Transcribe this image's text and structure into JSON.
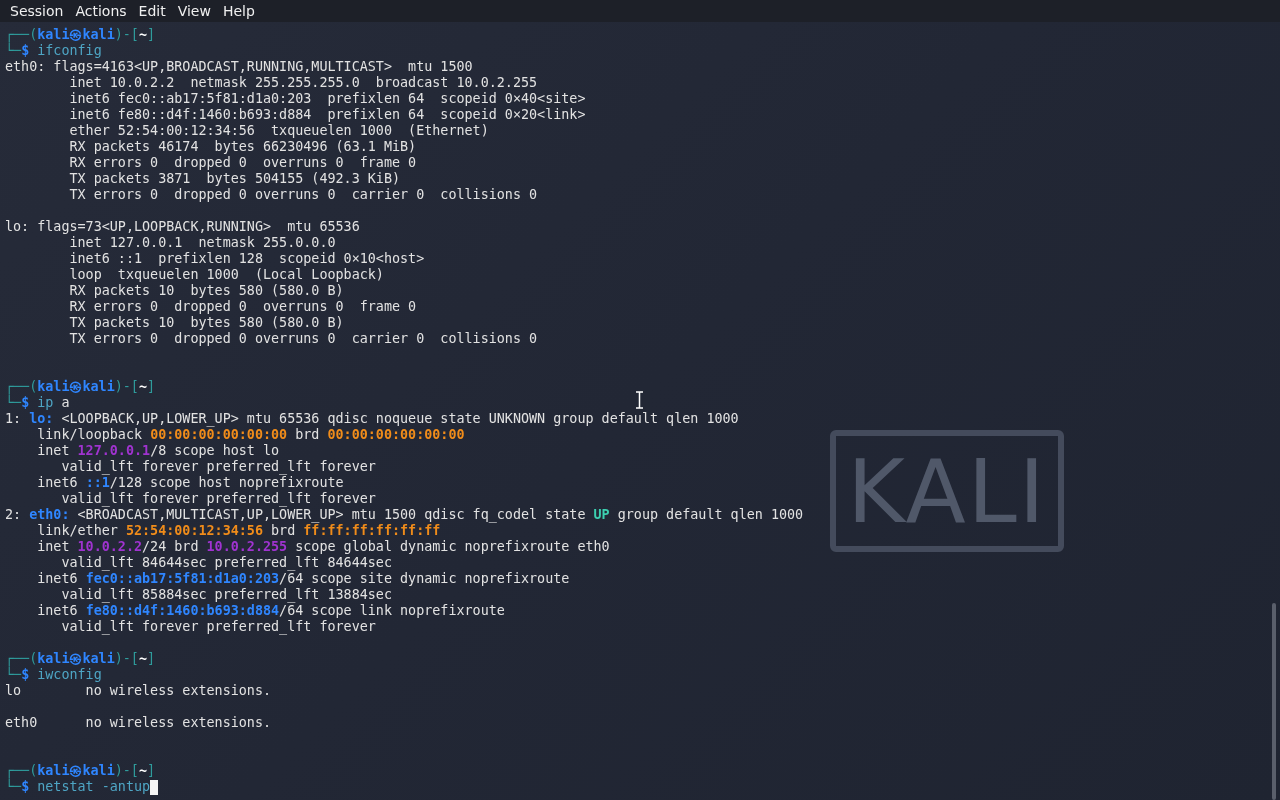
{
  "menu": [
    "Session",
    "Actions",
    "Edit",
    "View",
    "Help"
  ],
  "wallpaper": {
    "logo_text": "KALI"
  },
  "terminal": {
    "lines": [
      {
        "segments": [
          {
            "text": "┌──(",
            "kind": "frame"
          },
          {
            "text": "kali㉿kali",
            "kind": "userhost"
          },
          {
            "text": ")-[",
            "kind": "frame"
          },
          {
            "text": "~",
            "kind": "dir"
          },
          {
            "text": "]",
            "kind": "frame"
          }
        ]
      },
      {
        "segments": [
          {
            "text": "└─",
            "kind": "frame"
          },
          {
            "text": "$",
            "kind": "dollar"
          },
          {
            "text": " ifconfig",
            "kind": "command"
          }
        ]
      },
      {
        "segments": [
          {
            "text": "eth0: flags=4163<UP,BROADCAST,RUNNING,MULTICAST>  mtu 1500",
            "kind": "plain"
          }
        ]
      },
      {
        "segments": [
          {
            "text": "        inet 10.0.2.2  netmask 255.255.255.0  broadcast 10.0.2.255",
            "kind": "plain"
          }
        ]
      },
      {
        "segments": [
          {
            "text": "        inet6 fec0::ab17:5f81:d1a0:203  prefixlen 64  scopeid 0×40<site>",
            "kind": "plain"
          }
        ]
      },
      {
        "segments": [
          {
            "text": "        inet6 fe80::d4f:1460:b693:d884  prefixlen 64  scopeid 0×20<link>",
            "kind": "plain"
          }
        ]
      },
      {
        "segments": [
          {
            "text": "        ether 52:54:00:12:34:56  txqueuelen 1000  (Ethernet)",
            "kind": "plain"
          }
        ]
      },
      {
        "segments": [
          {
            "text": "        RX packets 46174  bytes 66230496 (63.1 MiB)",
            "kind": "plain"
          }
        ]
      },
      {
        "segments": [
          {
            "text": "        RX errors 0  dropped 0  overruns 0  frame 0",
            "kind": "plain"
          }
        ]
      },
      {
        "segments": [
          {
            "text": "        TX packets 3871  bytes 504155 (492.3 KiB)",
            "kind": "plain"
          }
        ]
      },
      {
        "segments": [
          {
            "text": "        TX errors 0  dropped 0 overruns 0  carrier 0  collisions 0",
            "kind": "plain"
          }
        ]
      },
      {
        "kind": "blank"
      },
      {
        "segments": [
          {
            "text": "lo: flags=73<UP,LOOPBACK,RUNNING>  mtu 65536",
            "kind": "plain"
          }
        ]
      },
      {
        "segments": [
          {
            "text": "        inet 127.0.0.1  netmask 255.0.0.0",
            "kind": "plain"
          }
        ]
      },
      {
        "segments": [
          {
            "text": "        inet6 ::1  prefixlen 128  scopeid 0×10<host>",
            "kind": "plain"
          }
        ]
      },
      {
        "segments": [
          {
            "text": "        loop  txqueuelen 1000  (Local Loopback)",
            "kind": "plain"
          }
        ]
      },
      {
        "segments": [
          {
            "text": "        RX packets 10  bytes 580 (580.0 B)",
            "kind": "plain"
          }
        ]
      },
      {
        "segments": [
          {
            "text": "        RX errors 0  dropped 0  overruns 0  frame 0",
            "kind": "plain"
          }
        ]
      },
      {
        "segments": [
          {
            "text": "        TX packets 10  bytes 580 (580.0 B)",
            "kind": "plain"
          }
        ]
      },
      {
        "segments": [
          {
            "text": "        TX errors 0  dropped 0 overruns 0  carrier 0  collisions 0",
            "kind": "plain"
          }
        ]
      },
      {
        "kind": "blank"
      },
      {
        "kind": "blank"
      },
      {
        "segments": [
          {
            "text": "┌──(",
            "kind": "frame"
          },
          {
            "text": "kali㉿kali",
            "kind": "userhost"
          },
          {
            "text": ")-[",
            "kind": "frame"
          },
          {
            "text": "~",
            "kind": "dir"
          },
          {
            "text": "]",
            "kind": "frame"
          }
        ]
      },
      {
        "segments": [
          {
            "text": "└─",
            "kind": "frame"
          },
          {
            "text": "$",
            "kind": "dollar"
          },
          {
            "text": " ip",
            "kind": "command"
          },
          {
            "text": " a",
            "kind": "plain"
          }
        ]
      },
      {
        "segments": [
          {
            "text": "1: ",
            "kind": "plain"
          },
          {
            "text": "lo:",
            "kind": "iface"
          },
          {
            "text": " <LOOPBACK,UP,LOWER_UP> mtu 65536 qdisc noqueue state UNKNOWN group default qlen 1000",
            "kind": "plain"
          }
        ]
      },
      {
        "segments": [
          {
            "text": "    link/loopback ",
            "kind": "plain"
          },
          {
            "text": "00:00:00:00:00:00",
            "kind": "mac"
          },
          {
            "text": " brd ",
            "kind": "plain"
          },
          {
            "text": "00:00:00:00:00:00",
            "kind": "mac"
          }
        ]
      },
      {
        "segments": [
          {
            "text": "    inet ",
            "kind": "plain"
          },
          {
            "text": "127.0.0.1",
            "kind": "ipv4"
          },
          {
            "text": "/8 scope host lo",
            "kind": "plain"
          }
        ]
      },
      {
        "segments": [
          {
            "text": "       valid_lft forever preferred_lft forever",
            "kind": "plain"
          }
        ]
      },
      {
        "segments": [
          {
            "text": "    inet6 ",
            "kind": "plain"
          },
          {
            "text": "::1",
            "kind": "ipv6"
          },
          {
            "text": "/128 scope host noprefixroute",
            "kind": "plain"
          }
        ]
      },
      {
        "segments": [
          {
            "text": "       valid_lft forever preferred_lft forever",
            "kind": "plain"
          }
        ]
      },
      {
        "segments": [
          {
            "text": "2: ",
            "kind": "plain"
          },
          {
            "text": "eth0:",
            "kind": "iface"
          },
          {
            "text": " <BROADCAST,MULTICAST,UP,LOWER_UP> mtu 1500 qdisc fq_codel state ",
            "kind": "plain"
          },
          {
            "text": "UP",
            "kind": "state"
          },
          {
            "text": " group default qlen 1000",
            "kind": "plain"
          }
        ]
      },
      {
        "segments": [
          {
            "text": "    link/ether ",
            "kind": "plain"
          },
          {
            "text": "52:54:00:12:34:56",
            "kind": "mac"
          },
          {
            "text": " brd ",
            "kind": "plain"
          },
          {
            "text": "ff:ff:ff:ff:ff:ff",
            "kind": "mac"
          }
        ]
      },
      {
        "segments": [
          {
            "text": "    inet ",
            "kind": "plain"
          },
          {
            "text": "10.0.2.2",
            "kind": "ipv4"
          },
          {
            "text": "/24 brd ",
            "kind": "plain"
          },
          {
            "text": "10.0.2.255",
            "kind": "ipv4"
          },
          {
            "text": " scope global dynamic noprefixroute eth0",
            "kind": "plain"
          }
        ]
      },
      {
        "segments": [
          {
            "text": "       valid_lft 84644sec preferred_lft 84644sec",
            "kind": "plain"
          }
        ]
      },
      {
        "segments": [
          {
            "text": "    inet6 ",
            "kind": "plain"
          },
          {
            "text": "fec0::ab17:5f81:d1a0:203",
            "kind": "ipv6"
          },
          {
            "text": "/64 scope site dynamic noprefixroute",
            "kind": "plain"
          }
        ]
      },
      {
        "segments": [
          {
            "text": "       valid_lft 85884sec preferred_lft 13884sec",
            "kind": "plain"
          }
        ]
      },
      {
        "segments": [
          {
            "text": "    inet6 ",
            "kind": "plain"
          },
          {
            "text": "fe80::d4f:1460:b693:d884",
            "kind": "ipv6"
          },
          {
            "text": "/64 scope link noprefixroute",
            "kind": "plain"
          }
        ]
      },
      {
        "segments": [
          {
            "text": "       valid_lft forever preferred_lft forever",
            "kind": "plain"
          }
        ]
      },
      {
        "kind": "blank"
      },
      {
        "segments": [
          {
            "text": "┌──(",
            "kind": "frame"
          },
          {
            "text": "kali㉿kali",
            "kind": "userhost"
          },
          {
            "text": ")-[",
            "kind": "frame"
          },
          {
            "text": "~",
            "kind": "dir"
          },
          {
            "text": "]",
            "kind": "frame"
          }
        ]
      },
      {
        "segments": [
          {
            "text": "└─",
            "kind": "frame"
          },
          {
            "text": "$",
            "kind": "dollar"
          },
          {
            "text": " iwconfig",
            "kind": "command"
          }
        ]
      },
      {
        "segments": [
          {
            "text": "lo        no wireless extensions.",
            "kind": "plain"
          }
        ]
      },
      {
        "kind": "blank"
      },
      {
        "segments": [
          {
            "text": "eth0      no wireless extensions.",
            "kind": "plain"
          }
        ]
      },
      {
        "kind": "blank"
      },
      {
        "kind": "blank"
      },
      {
        "segments": [
          {
            "text": "┌──(",
            "kind": "frame"
          },
          {
            "text": "kali㉿kali",
            "kind": "userhost"
          },
          {
            "text": ")-[",
            "kind": "frame"
          },
          {
            "text": "~",
            "kind": "dir"
          },
          {
            "text": "]",
            "kind": "frame"
          }
        ]
      },
      {
        "segments": [
          {
            "text": "└─",
            "kind": "frame"
          },
          {
            "text": "$",
            "kind": "dollar"
          },
          {
            "text": " netstat -antup",
            "kind": "command"
          }
        ],
        "cursor": true
      }
    ]
  }
}
